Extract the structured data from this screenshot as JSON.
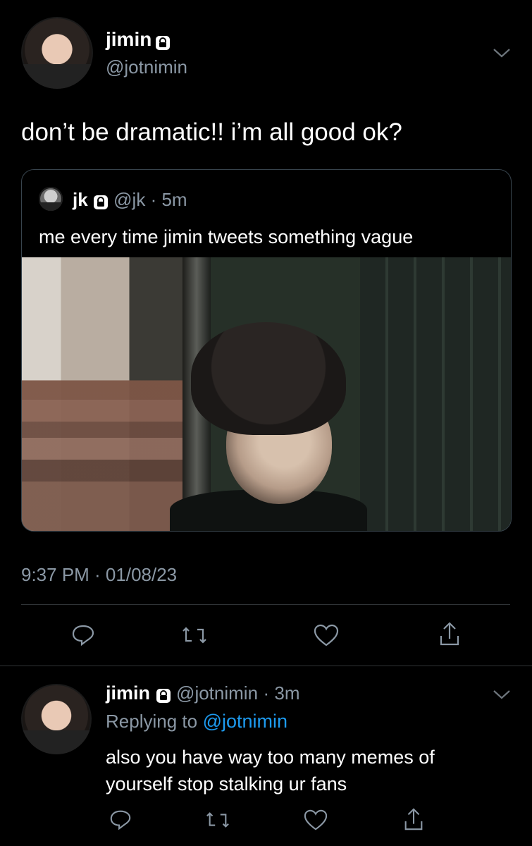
{
  "tweet": {
    "name": "jimin",
    "handle": "@jotnimin",
    "text": "don’t be dramatic!! i’m all good ok?",
    "timestamp": "9:37 PM · 01/08/23",
    "quote": {
      "name": "jk",
      "handle": "@jk",
      "dot_time": "· 5m",
      "text": "me every time jimin tweets something vague"
    },
    "actions": [
      "reply-icon",
      "retweet-icon",
      "like-icon",
      "share-icon"
    ]
  },
  "reply": {
    "name": "jimin",
    "handle": "@jotnimin",
    "dot_time": "· 3m",
    "replying_to_label": "Replying to",
    "replying_to_handle": "@jotnimin",
    "text_line1": "also you have way too many memes of",
    "text_line2": "yourself stop stalking ur fans",
    "actions": [
      "reply-icon",
      "retweet-icon",
      "like-icon",
      "share-icon"
    ]
  },
  "colors": {
    "background": "#000000",
    "secondary_text": "#8b98a5",
    "link": "#1d9bf0",
    "divider": "#2f3336"
  }
}
